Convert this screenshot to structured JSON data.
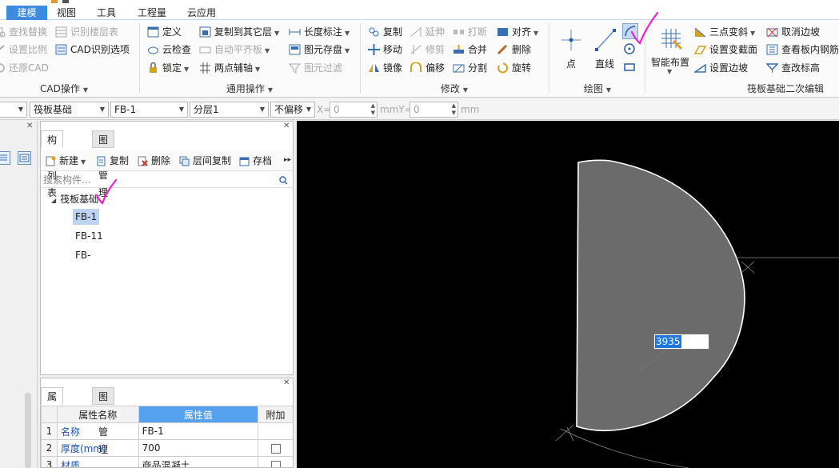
{
  "menu": {
    "tabs": [
      {
        "label": "建模",
        "active": true
      },
      {
        "label": "视图",
        "active": false
      },
      {
        "label": "工具",
        "active": false
      },
      {
        "label": "工程量",
        "active": false
      },
      {
        "label": "云应用",
        "active": false
      }
    ]
  },
  "ribbon": {
    "cad_group": {
      "label": "CAD操作",
      "items": [
        "查找替换",
        "识别楼层表",
        "设置比例",
        "CAD识别选项",
        "还原CAD"
      ]
    },
    "common_group": {
      "label": "通用操作",
      "items": [
        "定义",
        "复制到其它层",
        "长度标注",
        "云检查",
        "自动平齐板",
        "图元存盘",
        "锁定",
        "两点辅轴",
        "图元过滤"
      ]
    },
    "modify_group": {
      "label": "修改",
      "items": [
        "复制",
        "延伸",
        "打断",
        "对齐",
        "移动",
        "修剪",
        "合并",
        "删除",
        "镜像",
        "偏移",
        "分割",
        "旋转"
      ]
    },
    "draw_group": {
      "label": "绘图",
      "point": "点",
      "line": "直线"
    },
    "raft_group": {
      "label": "筏板基础二次编辑",
      "smart_layout": "智能布置",
      "items": [
        "三点变斜",
        "取消边坡",
        "设置变截面",
        "查看板内钢筋",
        "设置边坡",
        "查改标高"
      ]
    }
  },
  "toolbar2": {
    "type_combo": "筏板基础",
    "component_combo": "FB-1",
    "layer_combo": "分层1",
    "offset_combo": "不偏移",
    "x_label": "X=",
    "x_value": "0",
    "mm_y_label": "mmY=",
    "y_value": "0",
    "mm_label": "mm"
  },
  "component_panel": {
    "tabs": [
      "构件列表",
      "图纸管理"
    ],
    "tools": [
      "新建",
      "复制",
      "删除",
      "层间复制",
      "存档"
    ],
    "search_placeholder": "搜索构件...",
    "tree_root": "筏板基础",
    "items": [
      "FB-1",
      "FB-11",
      "FB-"
    ]
  },
  "property_panel": {
    "tabs": [
      "属性列表",
      "图层管理"
    ],
    "headers": [
      "属性名称",
      "属性值",
      "附加"
    ],
    "rows": [
      {
        "num": "1",
        "name": "名称",
        "value": "FB-1",
        "checkbox": false
      },
      {
        "num": "2",
        "name": "厚度(mm)",
        "value": "700",
        "checkbox": true
      },
      {
        "num": "3",
        "name": "材质",
        "value": "商品混凝土",
        "checkbox": true
      }
    ]
  },
  "canvas": {
    "dimension_value": "3935"
  },
  "colors": {
    "accent": "#3c8be0",
    "canvas_bg": "#000000",
    "shape_fill": "#6b6b6b",
    "check_mark": "#f020d0"
  }
}
